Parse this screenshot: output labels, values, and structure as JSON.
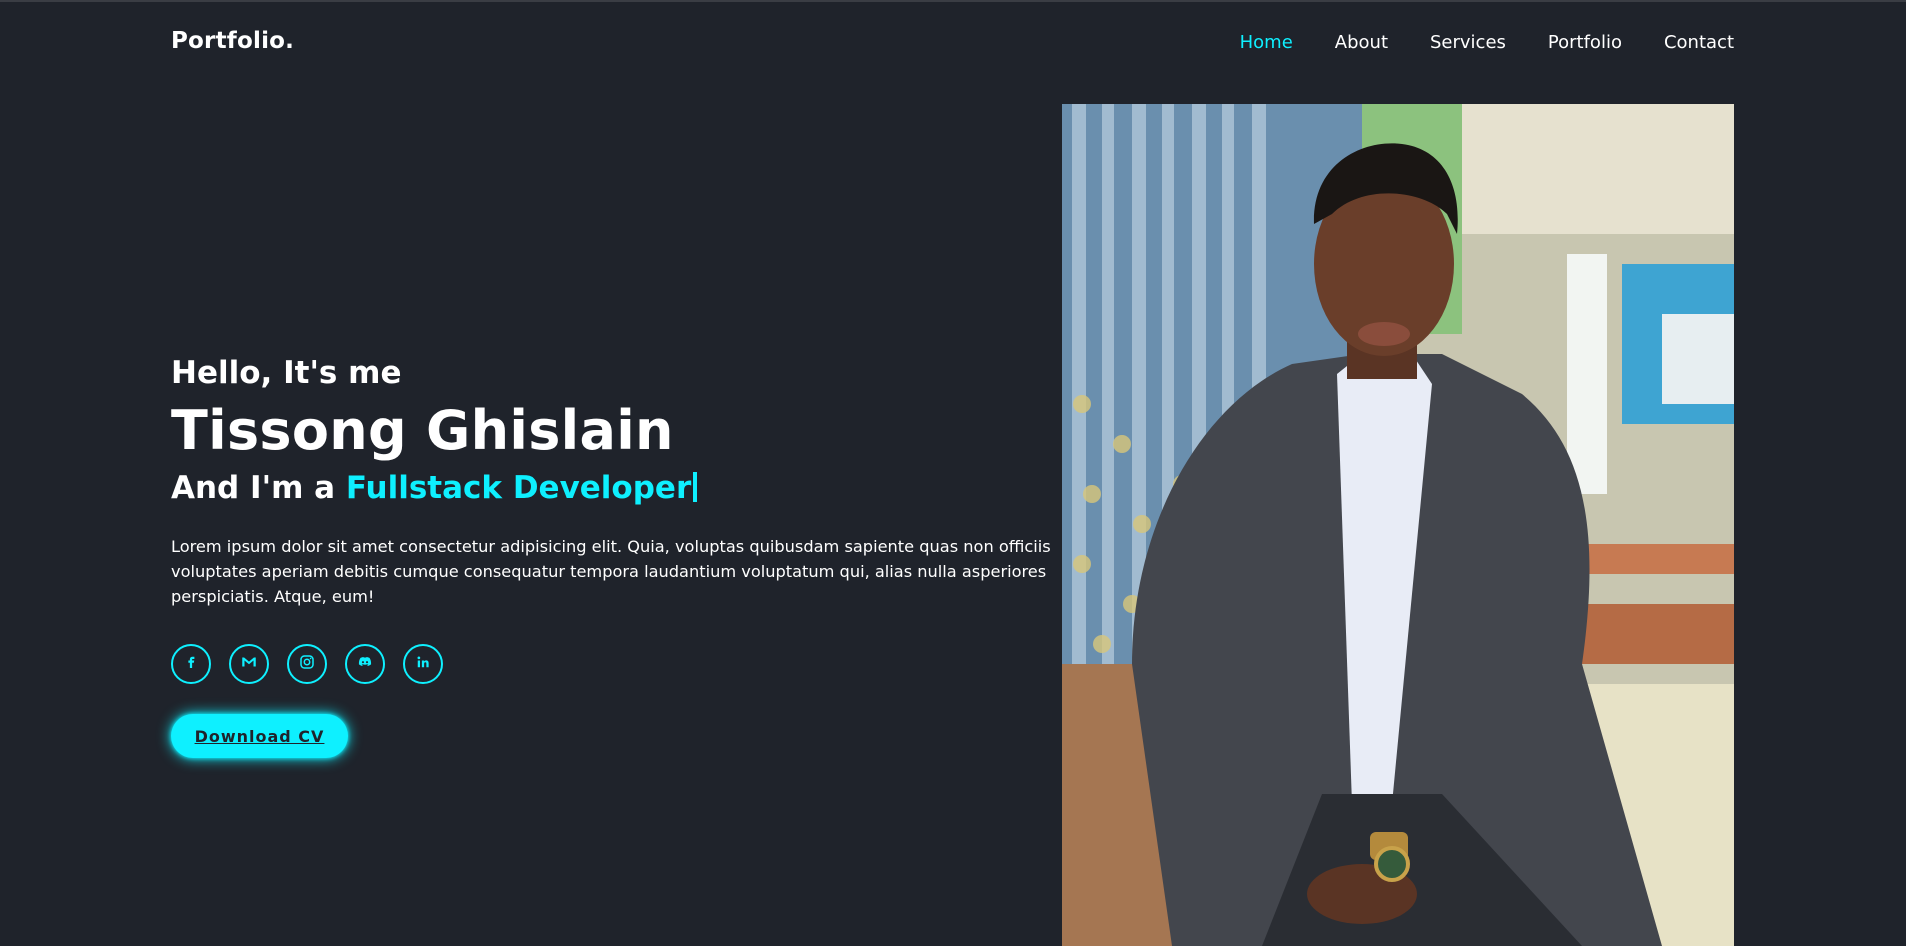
{
  "header": {
    "logo": "Portfolio.",
    "nav": [
      {
        "label": "Home",
        "active": true
      },
      {
        "label": "About",
        "active": false
      },
      {
        "label": "Services",
        "active": false
      },
      {
        "label": "Portfolio",
        "active": false
      },
      {
        "label": "Contact",
        "active": false
      }
    ]
  },
  "hero": {
    "greeting": "Hello, It's me",
    "name": "Tissong Ghislain",
    "role_prefix": "And I'm a",
    "role_highlight": "Fullstack Developer",
    "bio": "Lorem ipsum dolor sit amet consectetur adipisicing elit. Quia, voluptas quibusdam sapiente quas non officiis voluptates aperiam debitis cumque consequatur tempora laudantium voluptatum qui, alias nulla asperiores perspiciatis. Atque, eum!",
    "socials": [
      {
        "icon": "facebook-icon"
      },
      {
        "icon": "gmail-icon"
      },
      {
        "icon": "instagram-icon"
      },
      {
        "icon": "discord-icon"
      },
      {
        "icon": "linkedin-icon"
      }
    ],
    "cv_button": "Download CV"
  },
  "colors": {
    "background": "#1f232b",
    "accent": "#0ef0ff",
    "text": "#ffffff"
  }
}
